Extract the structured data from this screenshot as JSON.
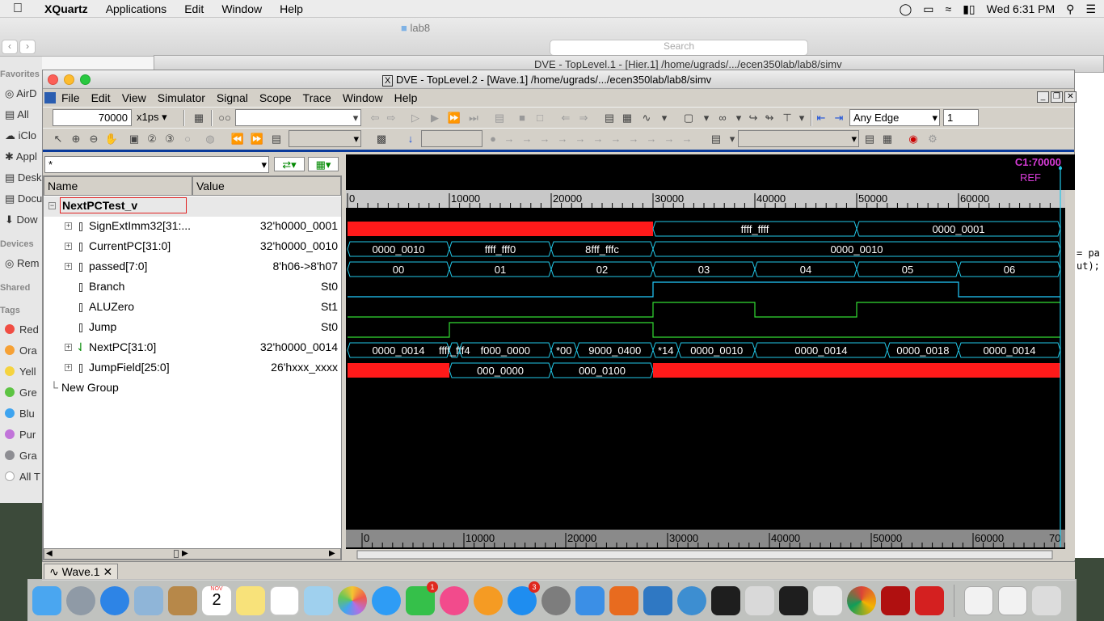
{
  "menubar": {
    "app_name": "XQuartz",
    "items": [
      "Applications",
      "Edit",
      "Window",
      "Help"
    ],
    "clock": "Wed 6:31 PM"
  },
  "finder": {
    "folder": "lab8",
    "search_placeholder": "Search",
    "sidebar": {
      "favorites_header": "Favorites",
      "favorites": [
        "AirD",
        "All",
        "iClo",
        "Appl",
        "Desk",
        "Docu",
        "Dow"
      ],
      "devices_header": "Devices",
      "devices": [
        "Rem"
      ],
      "shared_header": "Shared",
      "tags_header": "Tags",
      "tags": [
        {
          "label": "Red",
          "color": "#f04d43"
        },
        {
          "label": "Ora",
          "color": "#f6a135"
        },
        {
          "label": "Yell",
          "color": "#f5d33f"
        },
        {
          "label": "Gre",
          "color": "#5dc443"
        },
        {
          "label": "Blu",
          "color": "#3ea4ef"
        },
        {
          "label": "Pur",
          "color": "#c174d9"
        },
        {
          "label": "Gra",
          "color": "#8e8e93"
        },
        {
          "label": "All T",
          "color": "#ffffff"
        }
      ]
    }
  },
  "dve1": {
    "title": "DVE - TopLevel.1 - [Hier.1]  /home/ugrads/.../ecen350lab/lab8/simv"
  },
  "side_code": [
    "= pa",
    "ut);"
  ],
  "dve": {
    "title": "DVE - TopLevel.2 - [Wave.1]  /home/ugrads/.../ecen350lab/lab8/simv",
    "menu": [
      "File",
      "Edit",
      "View",
      "Simulator",
      "Signal",
      "Scope",
      "Trace",
      "Window",
      "Help"
    ],
    "time_value": "70000",
    "time_unit": "x1ps",
    "edge_select": "Any Edge",
    "edge_count": "1",
    "filter_value": "*",
    "col_name": "Name",
    "col_value": "Value",
    "group_name": "NextPCTest_v",
    "new_group": "New Group",
    "signals": [
      {
        "name": "SignExtImm32[31:...",
        "value": "32'h0000_0001",
        "expandable": true
      },
      {
        "name": "CurrentPC[31:0]",
        "value": "32'h0000_0010",
        "expandable": true
      },
      {
        "name": "passed[7:0]",
        "value": "8'h06->8'h07",
        "expandable": true
      },
      {
        "name": "Branch",
        "value": "St0",
        "expandable": false
      },
      {
        "name": "ALUZero",
        "value": "St1",
        "expandable": false
      },
      {
        "name": "Jump",
        "value": "St0",
        "expandable": false
      },
      {
        "name": "NextPC[31:0]",
        "value": "32'h0000_0014",
        "expandable": true
      },
      {
        "name": "JumpField[25:0]",
        "value": "26'hxxx_xxxx",
        "expandable": true
      }
    ],
    "cursor_label": "C1:70000",
    "ref_label": "REF",
    "time_ticks": [
      "0",
      "10000",
      "20000",
      "30000",
      "40000",
      "50000",
      "60000"
    ],
    "bottom_end_tick": "70",
    "tab_label": "Wave.1",
    "waves": [
      {
        "type": "bus",
        "segs": [
          [
            "x",
            0,
            30000,
            ""
          ],
          [
            "v",
            30000,
            50000,
            "ffff_ffff"
          ],
          [
            "v",
            50000,
            70000,
            "0000_0001"
          ]
        ]
      },
      {
        "type": "bus",
        "segs": [
          [
            "v",
            0,
            10000,
            "0000_0010"
          ],
          [
            "v",
            10000,
            20000,
            "ffff_fff0"
          ],
          [
            "v",
            20000,
            30000,
            "8fff_fffc"
          ],
          [
            "v",
            30000,
            70000,
            "0000_0010"
          ]
        ]
      },
      {
        "type": "bus",
        "segs": [
          [
            "v",
            0,
            10000,
            "00"
          ],
          [
            "v",
            10000,
            20000,
            "01"
          ],
          [
            "v",
            20000,
            30000,
            "02"
          ],
          [
            "v",
            30000,
            40000,
            "03"
          ],
          [
            "v",
            40000,
            50000,
            "04"
          ],
          [
            "v",
            50000,
            60000,
            "05"
          ],
          [
            "v",
            60000,
            70000,
            "06"
          ]
        ]
      },
      {
        "type": "bit",
        "color": "#22ccff",
        "edges": [
          [
            0,
            0
          ],
          [
            30000,
            1
          ],
          [
            60000,
            0
          ]
        ]
      },
      {
        "type": "bit",
        "color": "#33dd33",
        "edges": [
          [
            0,
            0
          ],
          [
            30000,
            1
          ],
          [
            40000,
            0
          ],
          [
            50000,
            1
          ]
        ]
      },
      {
        "type": "bit",
        "color": "#33dd33",
        "edges": [
          [
            0,
            0
          ],
          [
            10000,
            1
          ],
          [
            30000,
            0
          ]
        ]
      },
      {
        "type": "bus",
        "segs": [
          [
            "v",
            0,
            10000,
            "0000_0014"
          ],
          [
            "v",
            10000,
            11000,
            "ffff_fff4"
          ],
          [
            "v",
            11000,
            20000,
            "f000_0000"
          ],
          [
            "v",
            20000,
            22500,
            "*00"
          ],
          [
            "v",
            22500,
            30000,
            "9000_0400"
          ],
          [
            "v",
            30000,
            32500,
            "*14"
          ],
          [
            "v",
            32500,
            40000,
            "0000_0010"
          ],
          [
            "v",
            40000,
            53000,
            "0000_0014"
          ],
          [
            "v",
            53000,
            60000,
            "0000_0018"
          ],
          [
            "v",
            60000,
            70000,
            "0000_0014"
          ]
        ]
      },
      {
        "type": "bus",
        "segs": [
          [
            "x",
            0,
            10000,
            ""
          ],
          [
            "v",
            10000,
            20000,
            "000_0000"
          ],
          [
            "v",
            20000,
            30000,
            "000_0100"
          ],
          [
            "x",
            30000,
            70000,
            ""
          ]
        ]
      }
    ]
  },
  "dock": {
    "calendar_month": "NOV",
    "calendar_day": "2",
    "badges": [
      "1",
      "3"
    ],
    "icons": [
      "finder-icon",
      "launchpad-icon",
      "safari-icon",
      "mail-icon",
      "contacts-icon",
      "calendar-icon",
      "notes-icon",
      "reminders-icon",
      "preview-icon",
      "photos-icon",
      "messages-icon",
      "facetime-icon",
      "itunes-icon",
      "ibooks-icon",
      "appstore-icon",
      "system-preferences-icon",
      "xcode-icon",
      "matlab-icon",
      "vpn-icon",
      "quartus-icon",
      "terminal-icon",
      "xquartz-icon",
      "terminal-exec-icon",
      "vmware-icon",
      "chrome-icon",
      "acrobat-icon",
      "acrobat-reader-icon",
      "documents-folder-icon",
      "downloads-folder-icon",
      "trash-icon"
    ]
  }
}
